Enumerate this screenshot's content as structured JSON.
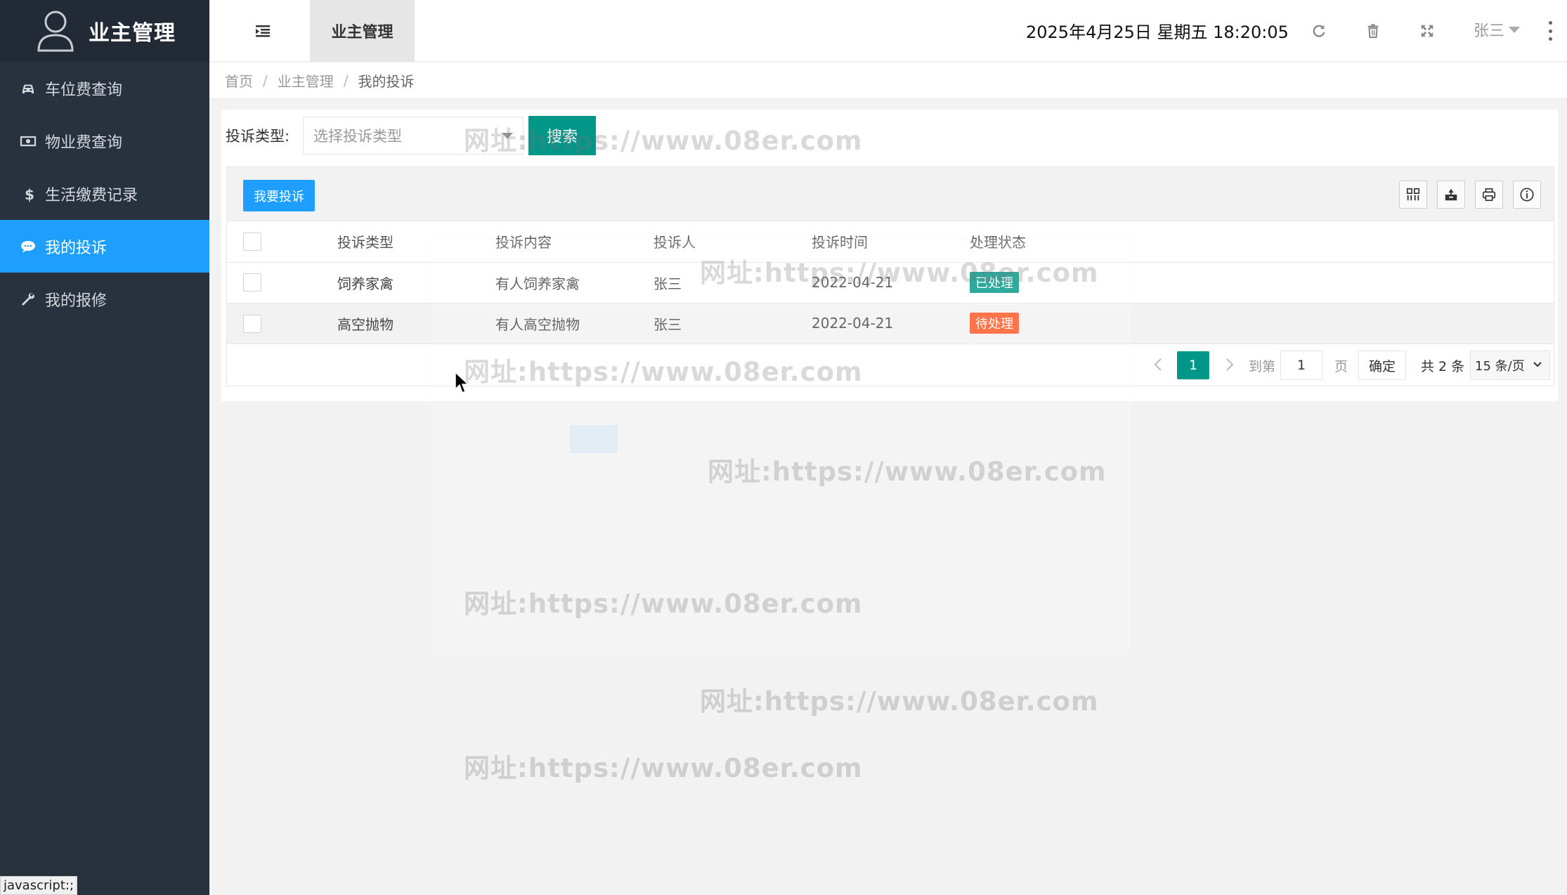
{
  "app": {
    "title": "业主管理",
    "header_tab": "业主管理",
    "clock": "2025年4月25日 星期五 18:20:05",
    "user": "张三"
  },
  "sidebar": {
    "items": [
      {
        "label": "车位费查询",
        "icon": "car-icon",
        "active": false
      },
      {
        "label": "物业费查询",
        "icon": "money-icon",
        "active": false
      },
      {
        "label": "生活缴费记录",
        "icon": "dollar-icon",
        "active": false
      },
      {
        "label": "我的投诉",
        "icon": "chat-icon",
        "active": true
      },
      {
        "label": "我的报修",
        "icon": "wrench-icon",
        "active": false
      }
    ]
  },
  "breadcrumb": [
    "首页",
    "业主管理",
    "我的投诉"
  ],
  "search": {
    "label": "投诉类型:",
    "placeholder": "选择投诉类型",
    "button": "搜索"
  },
  "toolbar": {
    "add_button": "我要投诉",
    "icons": [
      "columns-icon",
      "export-icon",
      "print-icon",
      "info-icon"
    ]
  },
  "table": {
    "columns": [
      "投诉类型",
      "投诉内容",
      "投诉人",
      "投诉时间",
      "处理状态"
    ],
    "rows": [
      {
        "type": "饲养家禽",
        "content": "有人饲养家禽",
        "person": "张三",
        "time": "2022-04-21",
        "status": "已处理",
        "status_color": "#009688"
      },
      {
        "type": "高空抛物",
        "content": "有人高空抛物",
        "person": "张三",
        "time": "2022-04-21",
        "status": "待处理",
        "status_color": "#ff5722"
      }
    ]
  },
  "pagination": {
    "current": "1",
    "goto_label": "到第",
    "goto_value": "1",
    "page_label": "页",
    "confirm": "确定",
    "total": "共 2 条",
    "page_size": "15 条/页"
  },
  "watermark": "网址:https://www.08er.com",
  "statusbar": "javascript:;",
  "colors": {
    "sidebar_bg": "#28323f",
    "accent_blue": "#1e9fff",
    "accent_green": "#009688",
    "warning_orange": "#ff5722"
  }
}
